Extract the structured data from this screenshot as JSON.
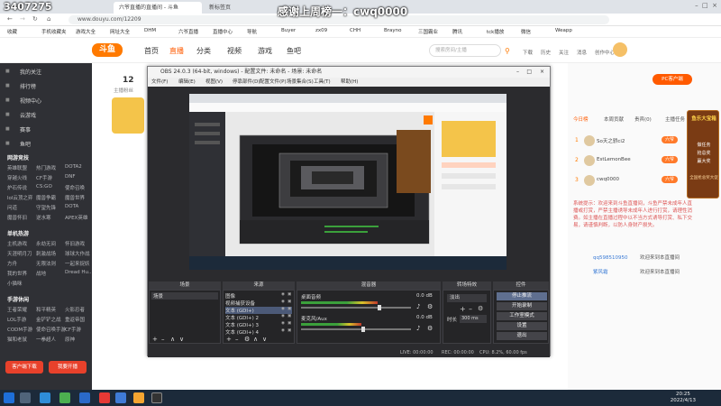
{
  "overlay": {
    "room_id": "3407275",
    "thanks": "感谢上周榜一：cwq0000"
  },
  "browser": {
    "tabs": [
      {
        "label": "六爷直播的直播间 - 斗鱼"
      },
      {
        "label": "新标签页"
      }
    ],
    "url": "www.douyu.com/12209",
    "bookmarks": [
      "收藏",
      "手机收藏夹",
      "游戏大全",
      "网址大全",
      "DHM",
      "六爷直播",
      "直播中心",
      "导航",
      "Buyer",
      "zx09",
      "CHH",
      "Brayno",
      "三国霸业",
      "腾讯",
      "tck播放",
      "微信",
      "Weapp"
    ]
  },
  "site": {
    "logo": "斗鱼",
    "nav": [
      "首页",
      "直播",
      "分类",
      "视频",
      "游戏",
      "鱼吧"
    ],
    "search_placeholder": "搜索房间/主播",
    "top_right": [
      "下载",
      "历史",
      "关注",
      "消息",
      "创作中心"
    ],
    "follower_count": "12",
    "follower_label": "主播粉丝"
  },
  "sidebar": {
    "items": [
      "我的关注",
      "排行榜",
      "视频中心",
      "云游戏",
      "赛事",
      "鱼吧"
    ],
    "sections": [
      {
        "title": "网游竞技",
        "games": [
          "英雄联盟",
          "热门游戏",
          "DOTA2",
          "穿越火线",
          "CF手游",
          "DNF",
          "炉石传说",
          "CS:GO",
          "使命召唤",
          "lol云顶之弈",
          "魔兽争霸",
          "魔兽世界",
          "问道",
          "守望先锋",
          "DOTA",
          "魔兽怀旧",
          "逆水寒",
          "APEX英雄"
        ]
      },
      {
        "title": "单机热游",
        "games": [
          "主机游戏",
          "永劫无间",
          "怀旧游戏",
          "天涯明月刀",
          "刺激战场",
          "球球大作战",
          "方舟",
          "无限法则",
          "一起来捉妖",
          "我的世界",
          "战地",
          "Dread Hu..",
          "小猫咪"
        ]
      },
      {
        "title": "手游休闲",
        "games": [
          "王者荣耀",
          "和平精英",
          "火影忍者",
          "LOL手游",
          "金铲铲之战",
          "重返帝国",
          "CODM手游",
          "使命召唤手游",
          "CF手游",
          "猫和老鼠",
          "一拳超人",
          "原神"
        ]
      }
    ],
    "btn_download": "客户端下载",
    "btn_open": "我要开播"
  },
  "obs": {
    "title": "OBS 24.0.3 (64-bit, windows) - 配置文件: 未命名 - 场景: 未命名",
    "menu": [
      "文件(F)",
      "编辑(E)",
      "视图(V)",
      "停靠部件(D)",
      "配置文件(P)",
      "场景集合(S)",
      "工具(T)",
      "帮助(H)"
    ],
    "docks": {
      "scenes": "场景",
      "sources": "来源",
      "mixer": "混音器",
      "transitions": "转场特效",
      "controls": "控件"
    },
    "scene_items": [
      "场景"
    ],
    "source_items": [
      "图像",
      "视频捕获设备",
      "文本 (GDI+)",
      "文本 (GDI+) 2",
      "文本 (GDI+) 3",
      "文本 (GDI+) 4"
    ],
    "mixer_tracks": [
      {
        "name": "桌面音频",
        "db": "0.0 dB",
        "level": 0.7
      },
      {
        "name": "麦克风/Aux",
        "db": "0.0 dB",
        "level": 0.55
      }
    ],
    "transition": {
      "type": "淡出",
      "duration_label": "时长",
      "duration": "300 ms"
    },
    "controls": [
      "停止推流",
      "开始录制",
      "工作室模式",
      "设置",
      "退出"
    ],
    "status": {
      "live": "LIVE: 00:00:00",
      "rec": "REC: 00:00:00",
      "cpu": "CPU: 8.2%, 60.00 fps"
    }
  },
  "right": {
    "pc_button": "PC客户端",
    "tabs": [
      "今日榜",
      "本周贡献",
      "贵宾(0)",
      "主播任务"
    ],
    "ranks": [
      {
        "name": "So天之骄ci2",
        "badge": "六爷"
      },
      {
        "name": "EstLemonBee",
        "badge": "六爷"
      },
      {
        "name": "cwq0000",
        "badge": "六爷"
      }
    ],
    "notice": "系统提示：欢迎来到斗鱼直播间，斗鱼严禁未成年人直播或打赏，严禁主播诱导未成年人进行打赏，请理性消费。如主播在直播过程中以不当方式诱导打赏、私下交易，请谨慎判断，以防人身财产损失。",
    "chat": [
      {
        "user": "qq598510950",
        "text": "欢迎来到本直播间"
      },
      {
        "user": "紫风霜",
        "text": "欢迎来到本直播间"
      }
    ],
    "ad_top": "鱼乐大宝箱",
    "ad_text": [
      "做任务",
      "抢总奖",
      "赢大奖"
    ],
    "ad_bottom": "全国抢总奖大促"
  },
  "taskbar": {
    "time": "20:25",
    "date": "2022/4/13"
  },
  "colors": {
    "accent": "#ff5a00",
    "sidebar_bg": "#2f3035",
    "obs_bg": "#2b2b2e",
    "taskbar_bg": "#1c2a3a"
  }
}
